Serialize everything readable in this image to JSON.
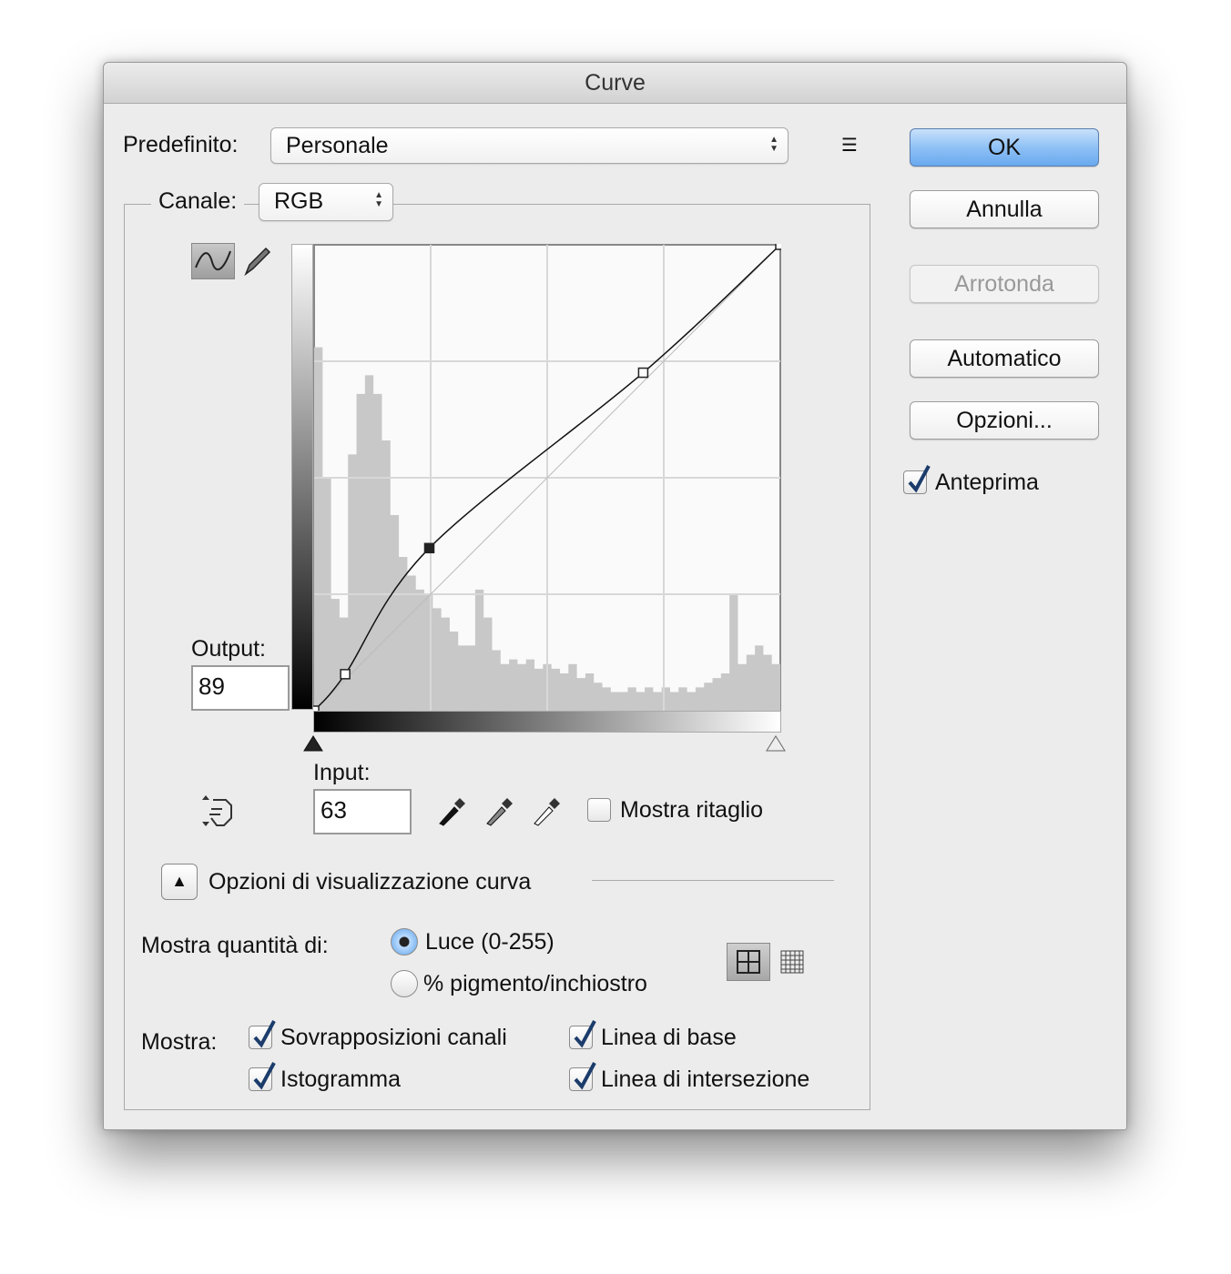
{
  "dialog": {
    "title": "Curve"
  },
  "preset": {
    "label": "Predefinito:",
    "value": "Personale"
  },
  "channel": {
    "label": "Canale:",
    "value": "RGB"
  },
  "buttons": {
    "ok": "OK",
    "cancel": "Annulla",
    "smooth": "Arrotonda",
    "auto": "Automatico",
    "options": "Opzioni..."
  },
  "preview": {
    "label": "Anteprima",
    "checked": true
  },
  "output": {
    "label": "Output:",
    "value": "89"
  },
  "input": {
    "label": "Input:",
    "value": "63"
  },
  "show_clipping": {
    "label": "Mostra ritaglio",
    "checked": false
  },
  "display_options": {
    "title": "Opzioni di visualizzazione curva",
    "show_amount_label": "Mostra quantità di:",
    "light": "Luce (0-255)",
    "pigment": "% pigmento/inchiostro",
    "show_label": "Mostra:",
    "channel_overlays": "Sovrapposizioni canali",
    "baseline": "Linea di base",
    "histogram": "Istogramma",
    "intersection_line": "Linea di intersezione"
  },
  "colors": {
    "accent": "#6aaaf0",
    "histogram": "#c8c8c8",
    "grid": "#d8d8d8"
  },
  "chart_data": {
    "type": "area",
    "title": "RGB curve",
    "xlim": [
      0,
      255
    ],
    "ylim": [
      0,
      255
    ],
    "grid": "4x4",
    "curve_points": [
      [
        0,
        0
      ],
      [
        17,
        20
      ],
      [
        63,
        89
      ],
      [
        180,
        185
      ],
      [
        255,
        255
      ]
    ],
    "selected_point": [
      63,
      89
    ],
    "histogram_relative": [
      0.78,
      0.5,
      0.24,
      0.2,
      0.55,
      0.68,
      0.72,
      0.68,
      0.58,
      0.42,
      0.33,
      0.29,
      0.26,
      0.25,
      0.22,
      0.2,
      0.17,
      0.14,
      0.14,
      0.26,
      0.2,
      0.13,
      0.1,
      0.11,
      0.1,
      0.11,
      0.09,
      0.1,
      0.09,
      0.08,
      0.1,
      0.07,
      0.08,
      0.06,
      0.05,
      0.04,
      0.04,
      0.05,
      0.04,
      0.05,
      0.04,
      0.05,
      0.04,
      0.05,
      0.04,
      0.05,
      0.06,
      0.07,
      0.08,
      0.25,
      0.1,
      0.12,
      0.14,
      0.12,
      0.1
    ]
  }
}
